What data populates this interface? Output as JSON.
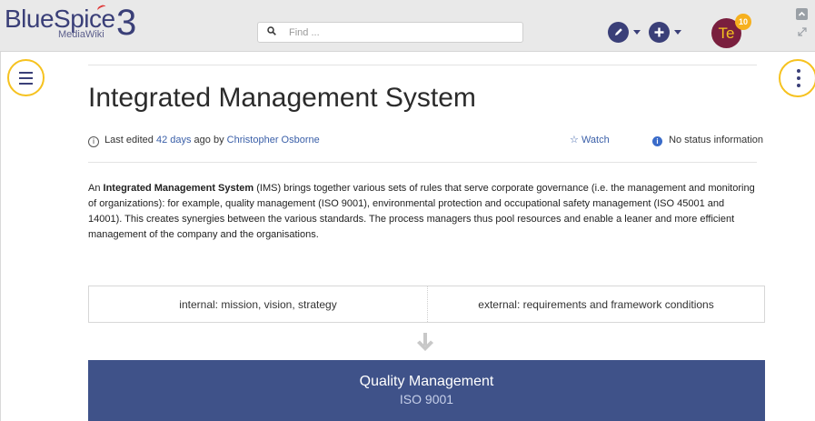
{
  "header": {
    "logo": {
      "word": "BlueSpice",
      "sub": "MediaWiki",
      "version": "3"
    },
    "search": {
      "placeholder": "Find ...",
      "value": ""
    },
    "edit_button_icon": "pencil-icon",
    "create_button_icon": "plus-icon",
    "user": {
      "initials": "Te",
      "notifications": "10"
    }
  },
  "colors": {
    "brand": "#3a3f78",
    "accent": "#f6c21f",
    "box_blue": "#3f5289",
    "link": "#3a5fa8"
  },
  "page": {
    "title": "Integrated Management System",
    "meta": {
      "prefix": "Last edited",
      "age": "42 days",
      "middle": "ago by",
      "author": "Christopher Osborne"
    },
    "watch_label": "Watch",
    "status_label": "No status information",
    "intro": {
      "lead": "An",
      "term": "Integrated Management System",
      "body": " (IMS) brings together various sets of rules that serve corporate governance (i.e. the management and monitoring of organizations): for example, quality management (ISO 9001), environmental protection and occupational safety management (ISO 45001 and 14001). This creates synergies between the various standards. The process managers thus pool resources and enable a leaner and more efficient management of the company and the organisations."
    }
  },
  "diagram": {
    "internal": "internal: mission, vision, strategy",
    "external": "external: requirements and framework conditions",
    "quality": {
      "title": "Quality Management",
      "subtitle": "ISO 9001"
    }
  }
}
